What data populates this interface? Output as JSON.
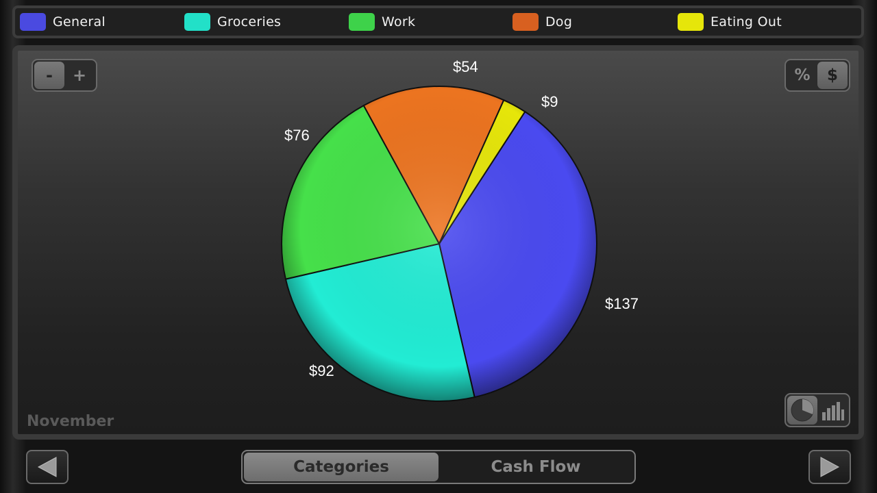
{
  "legend": [
    {
      "label": "General",
      "color": "#4a4ae0"
    },
    {
      "label": "Groceries",
      "color": "#22e0c8"
    },
    {
      "label": "Work",
      "color": "#3ed24a"
    },
    {
      "label": "Dog",
      "color": "#d86020"
    },
    {
      "label": "Eating Out",
      "color": "#e6e60a"
    }
  ],
  "controls": {
    "zoom_out_label": "-",
    "zoom_in_label": "+",
    "percent_label": "%",
    "dollar_label": "$",
    "pie_icon": "pie-chart-icon",
    "bar_icon": "bar-chart-icon"
  },
  "month": "November",
  "tabs": [
    {
      "label": "Categories",
      "active": true
    },
    {
      "label": "Cash Flow",
      "active": false
    }
  ],
  "nav": {
    "prev_icon": "left-arrow-icon",
    "next_icon": "right-arrow-icon"
  },
  "chart_data": {
    "type": "pie",
    "slices": [
      {
        "category": "General",
        "value": 137,
        "label": "$137",
        "color": "#4a4af0"
      },
      {
        "category": "Groceries",
        "value": 92,
        "label": "$92",
        "color": "#22ecd4"
      },
      {
        "category": "Work",
        "value": 76,
        "label": "$76",
        "color": "#46e04a"
      },
      {
        "category": "Dog",
        "value": 54,
        "label": "$54",
        "color": "#ec7420"
      },
      {
        "category": "Eating Out",
        "value": 9,
        "label": "$9",
        "color": "#e6e60a"
      }
    ],
    "legend_position": "top"
  }
}
